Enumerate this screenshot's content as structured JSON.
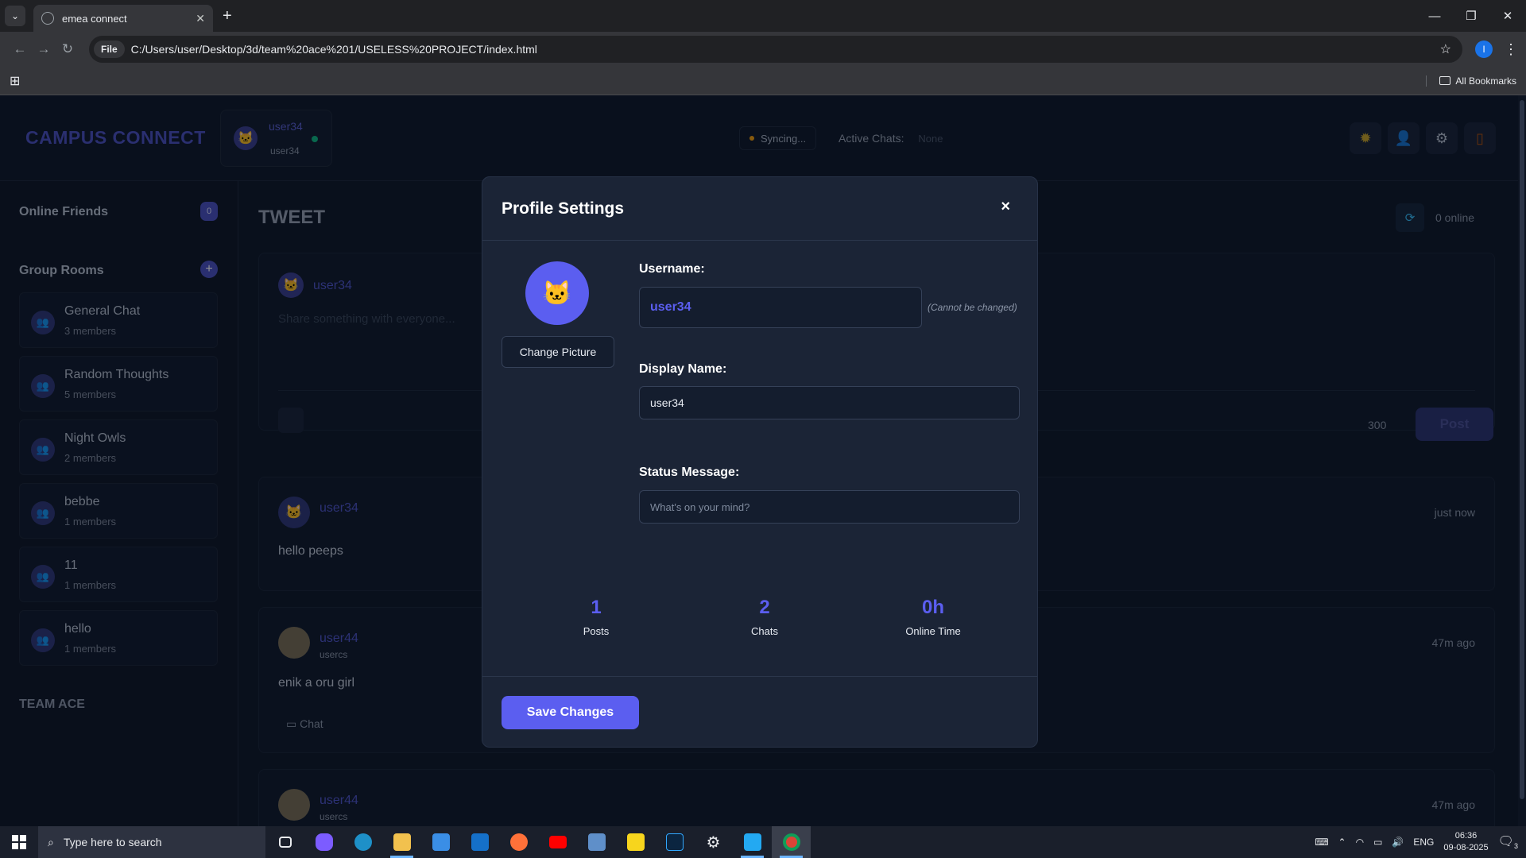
{
  "browser": {
    "tab_title": "emea connect",
    "file_chip": "File",
    "url": "C:/Users/user/Desktop/3d/team%20ace%201/USELESS%20PROJECT/index.html",
    "profile_initial": "I",
    "all_bookmarks": "All Bookmarks"
  },
  "header": {
    "brand": "CAMPUS CONNECT",
    "user_name": "user34",
    "user_sub": "user34",
    "sync_status": "Syncing...",
    "active_chats_label": "Active Chats:",
    "active_chats_value": "None",
    "icons": [
      "sun-icon",
      "profile-icon",
      "settings-icon",
      "logout-icon"
    ]
  },
  "sidebar": {
    "online_friends": "Online Friends",
    "online_count": "0",
    "group_rooms": "Group Rooms",
    "rooms": [
      {
        "name": "General Chat",
        "members": "3 members"
      },
      {
        "name": "Random Thoughts",
        "members": "5 members"
      },
      {
        "name": "Night Owls",
        "members": "2 members"
      },
      {
        "name": "bebbe",
        "members": "1 members"
      },
      {
        "name": "11",
        "members": "1 members"
      },
      {
        "name": "hello",
        "members": "1 members"
      }
    ],
    "team": "TEAM ACE"
  },
  "main": {
    "title": "TWEET",
    "online": "0 online",
    "composer": {
      "user": "user34",
      "placeholder": "Share something with everyone...",
      "char_count": "300",
      "post_label": "Post"
    },
    "posts": [
      {
        "user": "user34",
        "handle": "",
        "time": "just now",
        "text": "hello peeps"
      },
      {
        "user": "user44",
        "handle": "usercs",
        "time": "47m ago",
        "text": "enik a oru girl",
        "chat": "Chat"
      },
      {
        "user": "user44",
        "handle": "usercs",
        "time": "47m ago"
      }
    ]
  },
  "modal": {
    "title": "Profile Settings",
    "close": "×",
    "change_picture": "Change Picture",
    "username_label": "Username:",
    "username_value": "user34",
    "cannot_change": "(Cannot be changed)",
    "display_name_label": "Display Name:",
    "display_name_value": "user34",
    "status_label": "Status Message:",
    "status_placeholder": "What's on your mind?",
    "stats": [
      {
        "value": "1",
        "label": "Posts"
      },
      {
        "value": "2",
        "label": "Chats"
      },
      {
        "value": "0h",
        "label": "Online Time"
      }
    ],
    "save": "Save Changes"
  },
  "taskbar": {
    "search_placeholder": "Type here to search",
    "lang": "ENG",
    "time": "06:36",
    "date": "09-08-2025",
    "notifications": "3"
  }
}
